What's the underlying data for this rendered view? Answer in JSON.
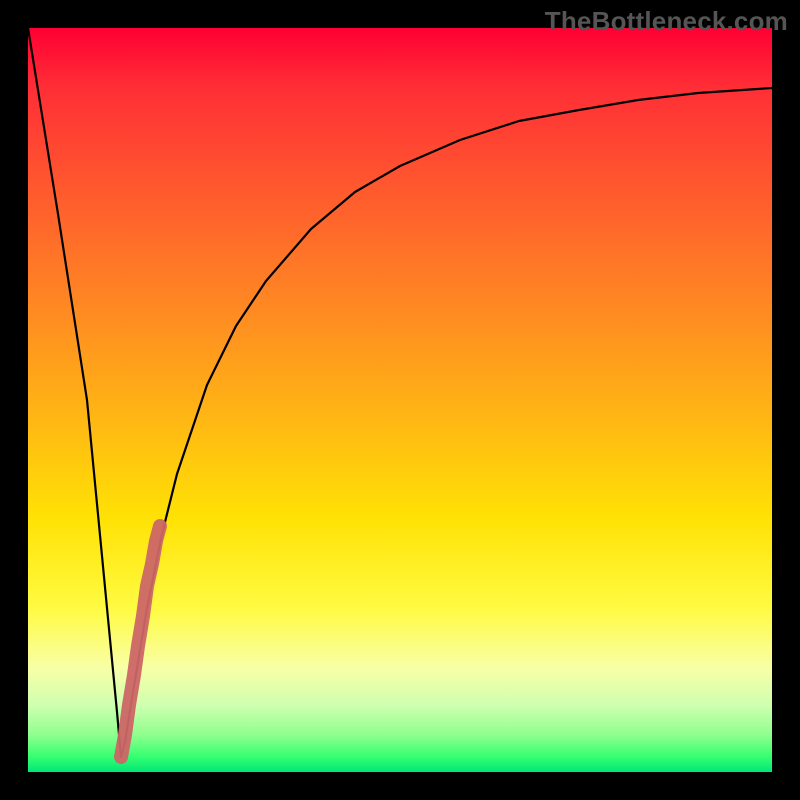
{
  "watermark": {
    "text": "TheBottleneck.com"
  },
  "chart_data": {
    "type": "line",
    "title": "",
    "xlabel": "",
    "ylabel": "",
    "xlim": [
      0,
      100
    ],
    "ylim": [
      0,
      100
    ],
    "series": [
      {
        "name": "curve",
        "x": [
          0,
          4,
          8,
          12,
          12.5,
          13,
          14,
          16,
          18,
          20,
          24,
          28,
          32,
          38,
          44,
          50,
          58,
          66,
          74,
          82,
          90,
          100
        ],
        "y": [
          100,
          75,
          50,
          8,
          2,
          4,
          10,
          22,
          32,
          40,
          52,
          60,
          66,
          73,
          78,
          81.5,
          85,
          87.5,
          89,
          90.3,
          91.3,
          92
        ]
      },
      {
        "name": "highlight",
        "x": [
          12.5,
          13.0,
          13.6,
          14.2,
          14.8,
          15.4,
          16.0,
          16.6,
          17.2,
          17.8
        ],
        "y": [
          2,
          5,
          9,
          13,
          17,
          21,
          25,
          28,
          31,
          33
        ]
      }
    ],
    "colors": {
      "curve": "#000000",
      "highlight": "#cc6666",
      "gradient_top": "#ff0033",
      "gradient_mid": "#ffe205",
      "gradient_bottom": "#00e676"
    }
  }
}
